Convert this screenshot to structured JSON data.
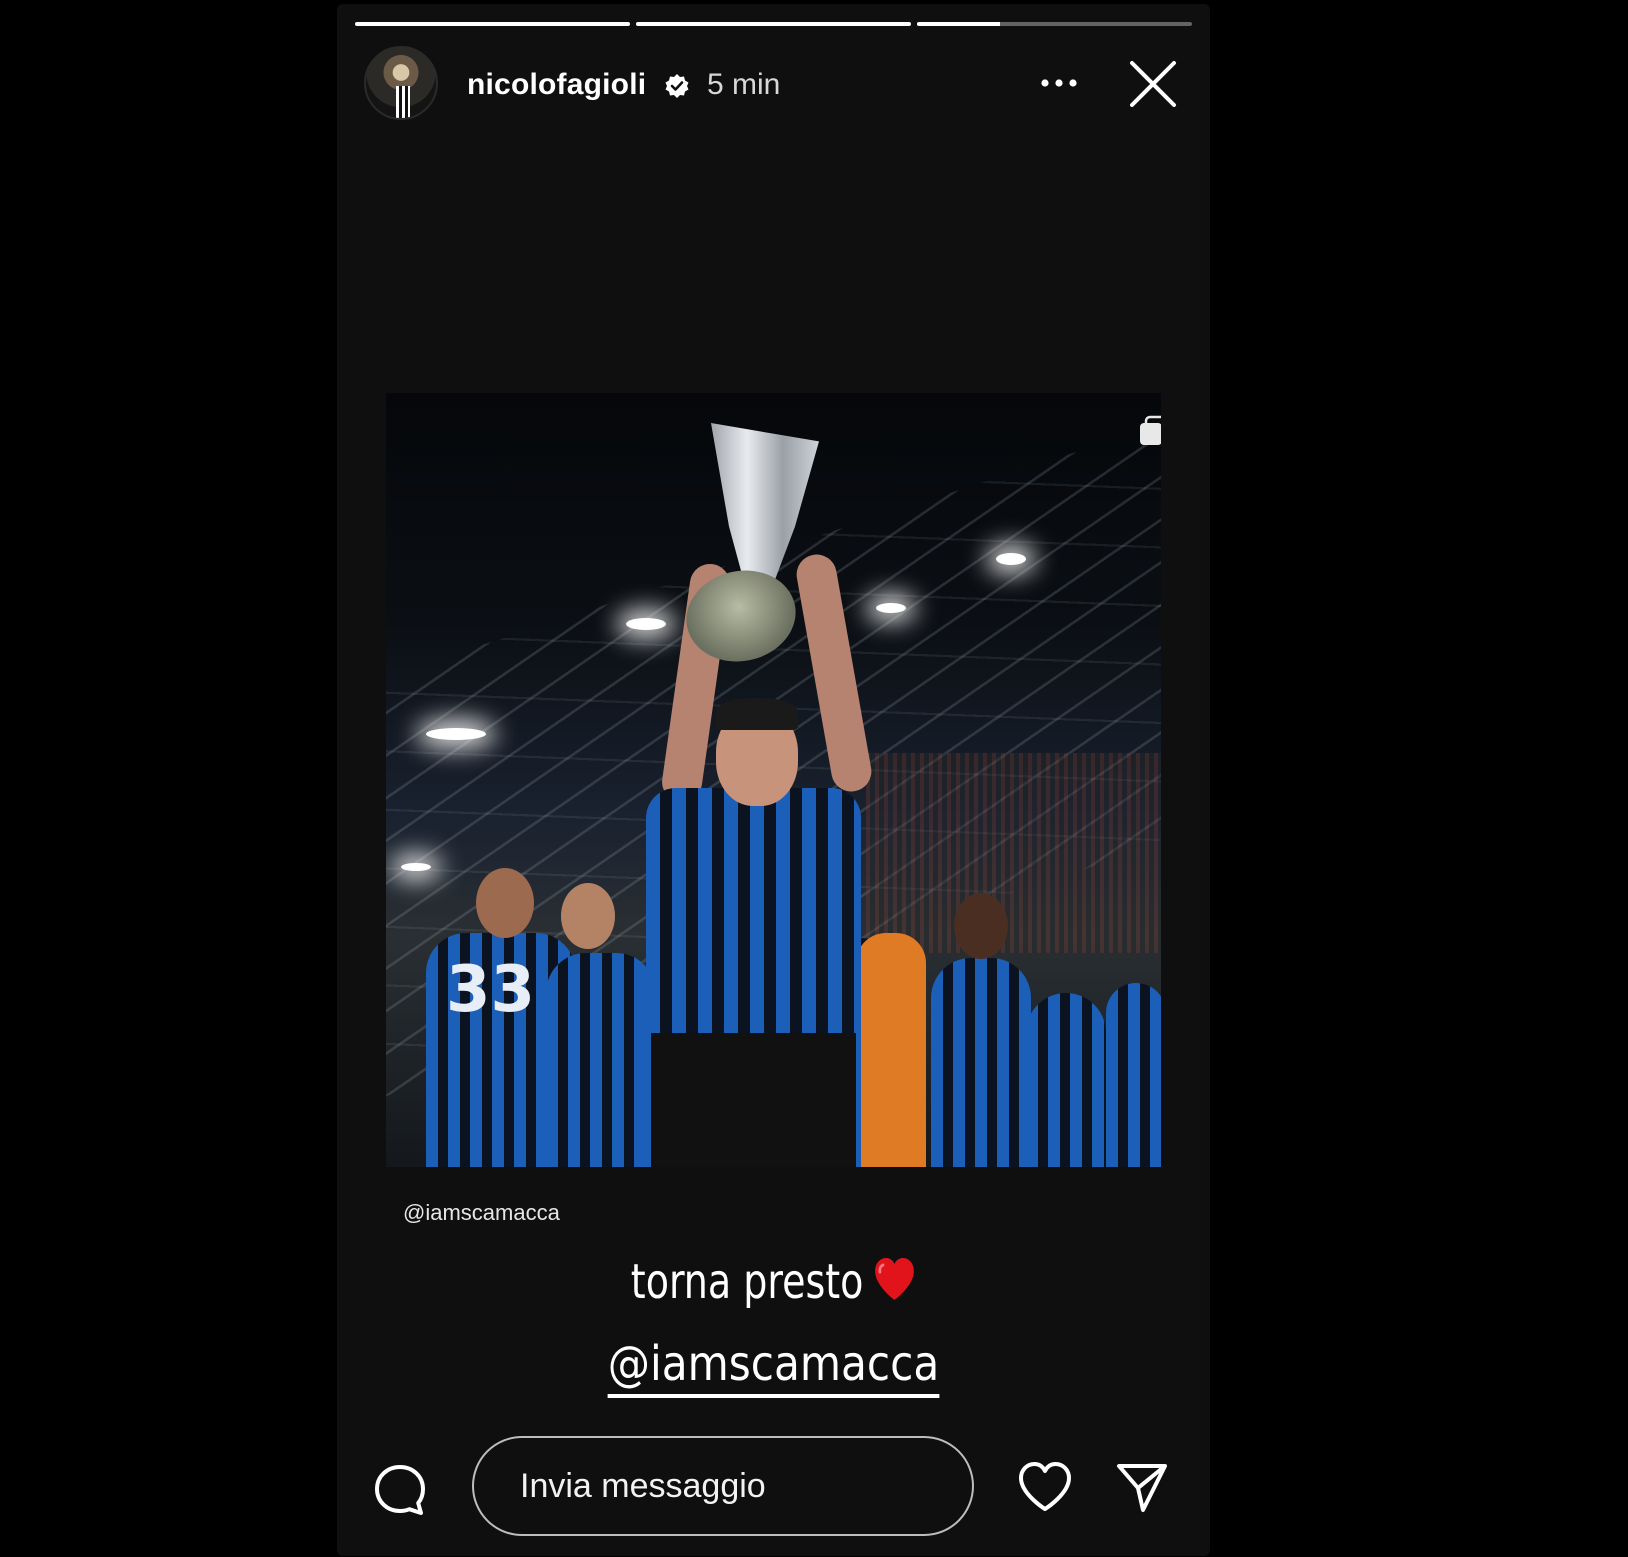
{
  "story": {
    "progress": [
      1.0,
      1.0,
      0.3
    ],
    "author": {
      "username": "nicolofagioli",
      "verified": true
    },
    "time_ago": "5 min",
    "menu_icon": "more-horizontal-icon",
    "close_icon": "close-icon"
  },
  "post": {
    "photo_alt": "photo",
    "multi_icon": "multiple-photos-icon",
    "credit": "@iamscamacca",
    "jersey_number": "33",
    "caption": "torna presto",
    "caption_emoji": "red-heart-icon",
    "mention": "@iamscamacca"
  },
  "reply_bar": {
    "placeholder": "Invia messaggio",
    "camera_icon": "message-bubble-icon",
    "like_icon": "heart-icon",
    "share_icon": "send-icon"
  },
  "colors": {
    "background": "#000000",
    "story_bg": "#0f0f10",
    "text": "#ffffff",
    "heart_red": "#e1141c",
    "jersey_blue": "#1c5fb8"
  }
}
